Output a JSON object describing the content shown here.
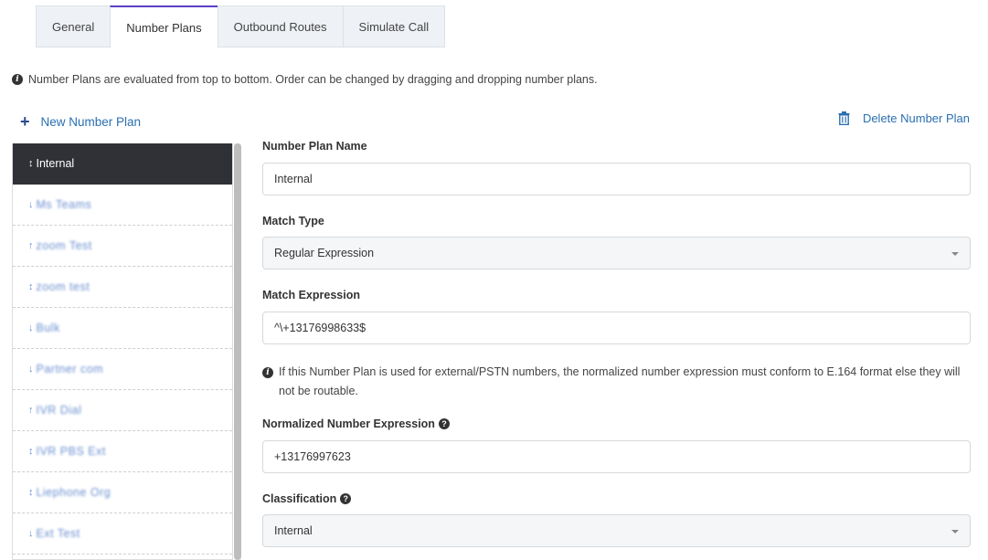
{
  "tabs": [
    {
      "label": "General"
    },
    {
      "label": "Number Plans"
    },
    {
      "label": "Outbound Routes"
    },
    {
      "label": "Simulate Call"
    }
  ],
  "info_text": "Number Plans are evaluated from top to bottom. Order can be changed by dragging and dropping number plans.",
  "new_plan_label": "New Number Plan",
  "delete_plan_label": "Delete Number Plan",
  "plans": [
    {
      "label": "Internal",
      "arrow": "↕"
    },
    {
      "label": "Ms Teams",
      "arrow": "↓"
    },
    {
      "label": "zoom Test",
      "arrow": "↑"
    },
    {
      "label": "zoom test",
      "arrow": "↕"
    },
    {
      "label": "Bulk",
      "arrow": "↓"
    },
    {
      "label": "Partner com",
      "arrow": "↓"
    },
    {
      "label": "IVR Dial",
      "arrow": "↑"
    },
    {
      "label": "IVR PBS Ext",
      "arrow": "↕"
    },
    {
      "label": "Liephone Org",
      "arrow": "↕"
    },
    {
      "label": "Ext Test",
      "arrow": "↓"
    }
  ],
  "form": {
    "name_label": "Number Plan Name",
    "name_value": "Internal",
    "match_type_label": "Match Type",
    "match_type_value": "Regular Expression",
    "match_expr_label": "Match Expression",
    "match_expr_value": "^\\+13176998633$",
    "note": "If this Number Plan is used for external/PSTN numbers, the normalized number expression must conform to E.164 format else they will not be routable.",
    "normalized_label": "Normalized Number Expression",
    "normalized_value": "+13176997623",
    "classification_label": "Classification",
    "classification_value": "Internal"
  },
  "colors": {
    "accent": "#5b3fc4",
    "link": "#2a6fb0",
    "active_item_bg": "#2f3136"
  }
}
